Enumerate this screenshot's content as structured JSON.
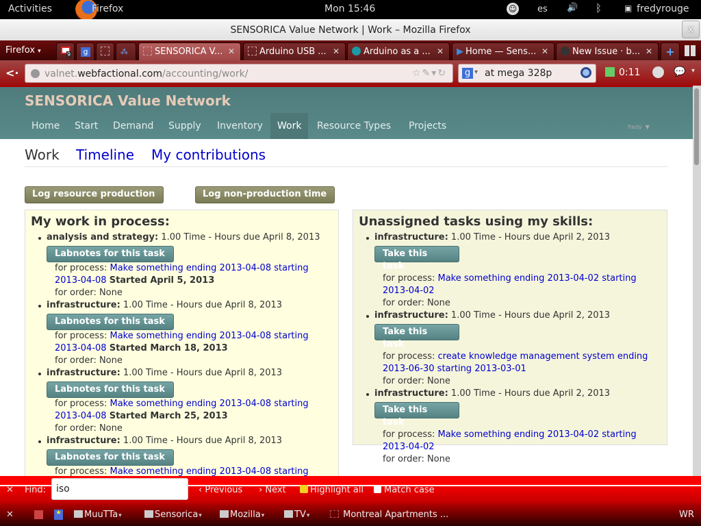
{
  "system_bar": {
    "activities": "Activities",
    "app_name": "Firefox",
    "clock": "Mon 15:46",
    "keyboard_layout": "es",
    "username": "fredyrouge"
  },
  "window": {
    "title": "SENSORICA Value Network | Work – Mozilla Firefox",
    "close_label": "x"
  },
  "browser": {
    "menu_label": "Firefox",
    "tabs": [
      {
        "label": "SENSORICA V...",
        "active": true
      },
      {
        "label": "Arduino USB ...",
        "active": false
      },
      {
        "label": "Arduino as a ...",
        "active": false
      },
      {
        "label": "Home — Sens...",
        "active": false
      },
      {
        "label": "New Issue · b...",
        "active": false
      }
    ],
    "pinned_tab_badges": {
      "gmail_count": "9"
    },
    "url_prefix": "valnet.",
    "url_domain": "webfactional.com",
    "url_path": "/accounting/work/",
    "search_value": "at mega 328p",
    "download_time": "0:11"
  },
  "site": {
    "brand": "SENSORICA Value Network",
    "nav": [
      "Home",
      "Start",
      "Demand",
      "Supply",
      "Inventory",
      "Work",
      "Resource Types",
      "Projects"
    ],
    "active_nav": "Work",
    "user_menu": "fredy",
    "subnav": {
      "current": "Work",
      "links": [
        "Timeline",
        "My contributions"
      ]
    },
    "buttons": {
      "log_production": "Log resource production",
      "log_non_production": "Log non-production time"
    },
    "my_work": {
      "heading": "My work in process:",
      "button_label": "Labnotes for this task",
      "process_label": "for process:",
      "order_label": "for order: None",
      "items": [
        {
          "skill": "analysis and strategy:",
          "summary": "1.00 Time - Hours due April 8, 2013",
          "process_line1": "Make something ending 2013-04-08 starting",
          "process_line2": "2013-04-08",
          "started": "Started April 5, 2013"
        },
        {
          "skill": "infrastructure:",
          "summary": "1.00 Time - Hours due April 8, 2013",
          "process_line1": "Make something ending 2013-04-08 starting",
          "process_line2": "2013-04-08",
          "started": "Started March 18, 2013"
        },
        {
          "skill": "infrastructure:",
          "summary": "1.00 Time - Hours due April 8, 2013",
          "process_line1": "Make something ending 2013-04-08 starting",
          "process_line2": "2013-04-08",
          "started": "Started March 25, 2013"
        },
        {
          "skill": "infrastructure:",
          "summary": "1.00 Time - Hours due April 8, 2013",
          "process_line1": "Make something ending 2013-04-08 starting"
        }
      ]
    },
    "unassigned": {
      "heading": "Unassigned tasks using my skills:",
      "button_label": "Take this task",
      "process_label": "for process:",
      "order_label": "for order: None",
      "items": [
        {
          "skill": "infrastructure:",
          "summary": "1.00 Time - Hours due April 2, 2013",
          "process_line1": "Make something ending 2013-04-02 starting",
          "process_line2": "2013-04-02"
        },
        {
          "skill": "infrastructure:",
          "summary": "1.00 Time - Hours due April 2, 2013",
          "process_line1": "create knowledge management system ending",
          "process_line2": "2013-06-30 starting 2013-03-01"
        },
        {
          "skill": "infrastructure:",
          "summary": "1.00 Time - Hours due April 2, 2013",
          "process_line1": "Make something ending 2013-04-02 starting",
          "process_line2": "2013-04-02"
        }
      ]
    }
  },
  "findbar": {
    "label": "Find:",
    "value": "iso",
    "previous": "Previous",
    "next": "Next",
    "highlight_all": "Highlight all",
    "match_case": "Match case"
  },
  "bookmarks": {
    "folders": [
      "MuuTTa",
      "Sensorica",
      "Mozilla",
      "TV"
    ],
    "link": "Montreal Apartments ...",
    "right_label": "WR"
  }
}
